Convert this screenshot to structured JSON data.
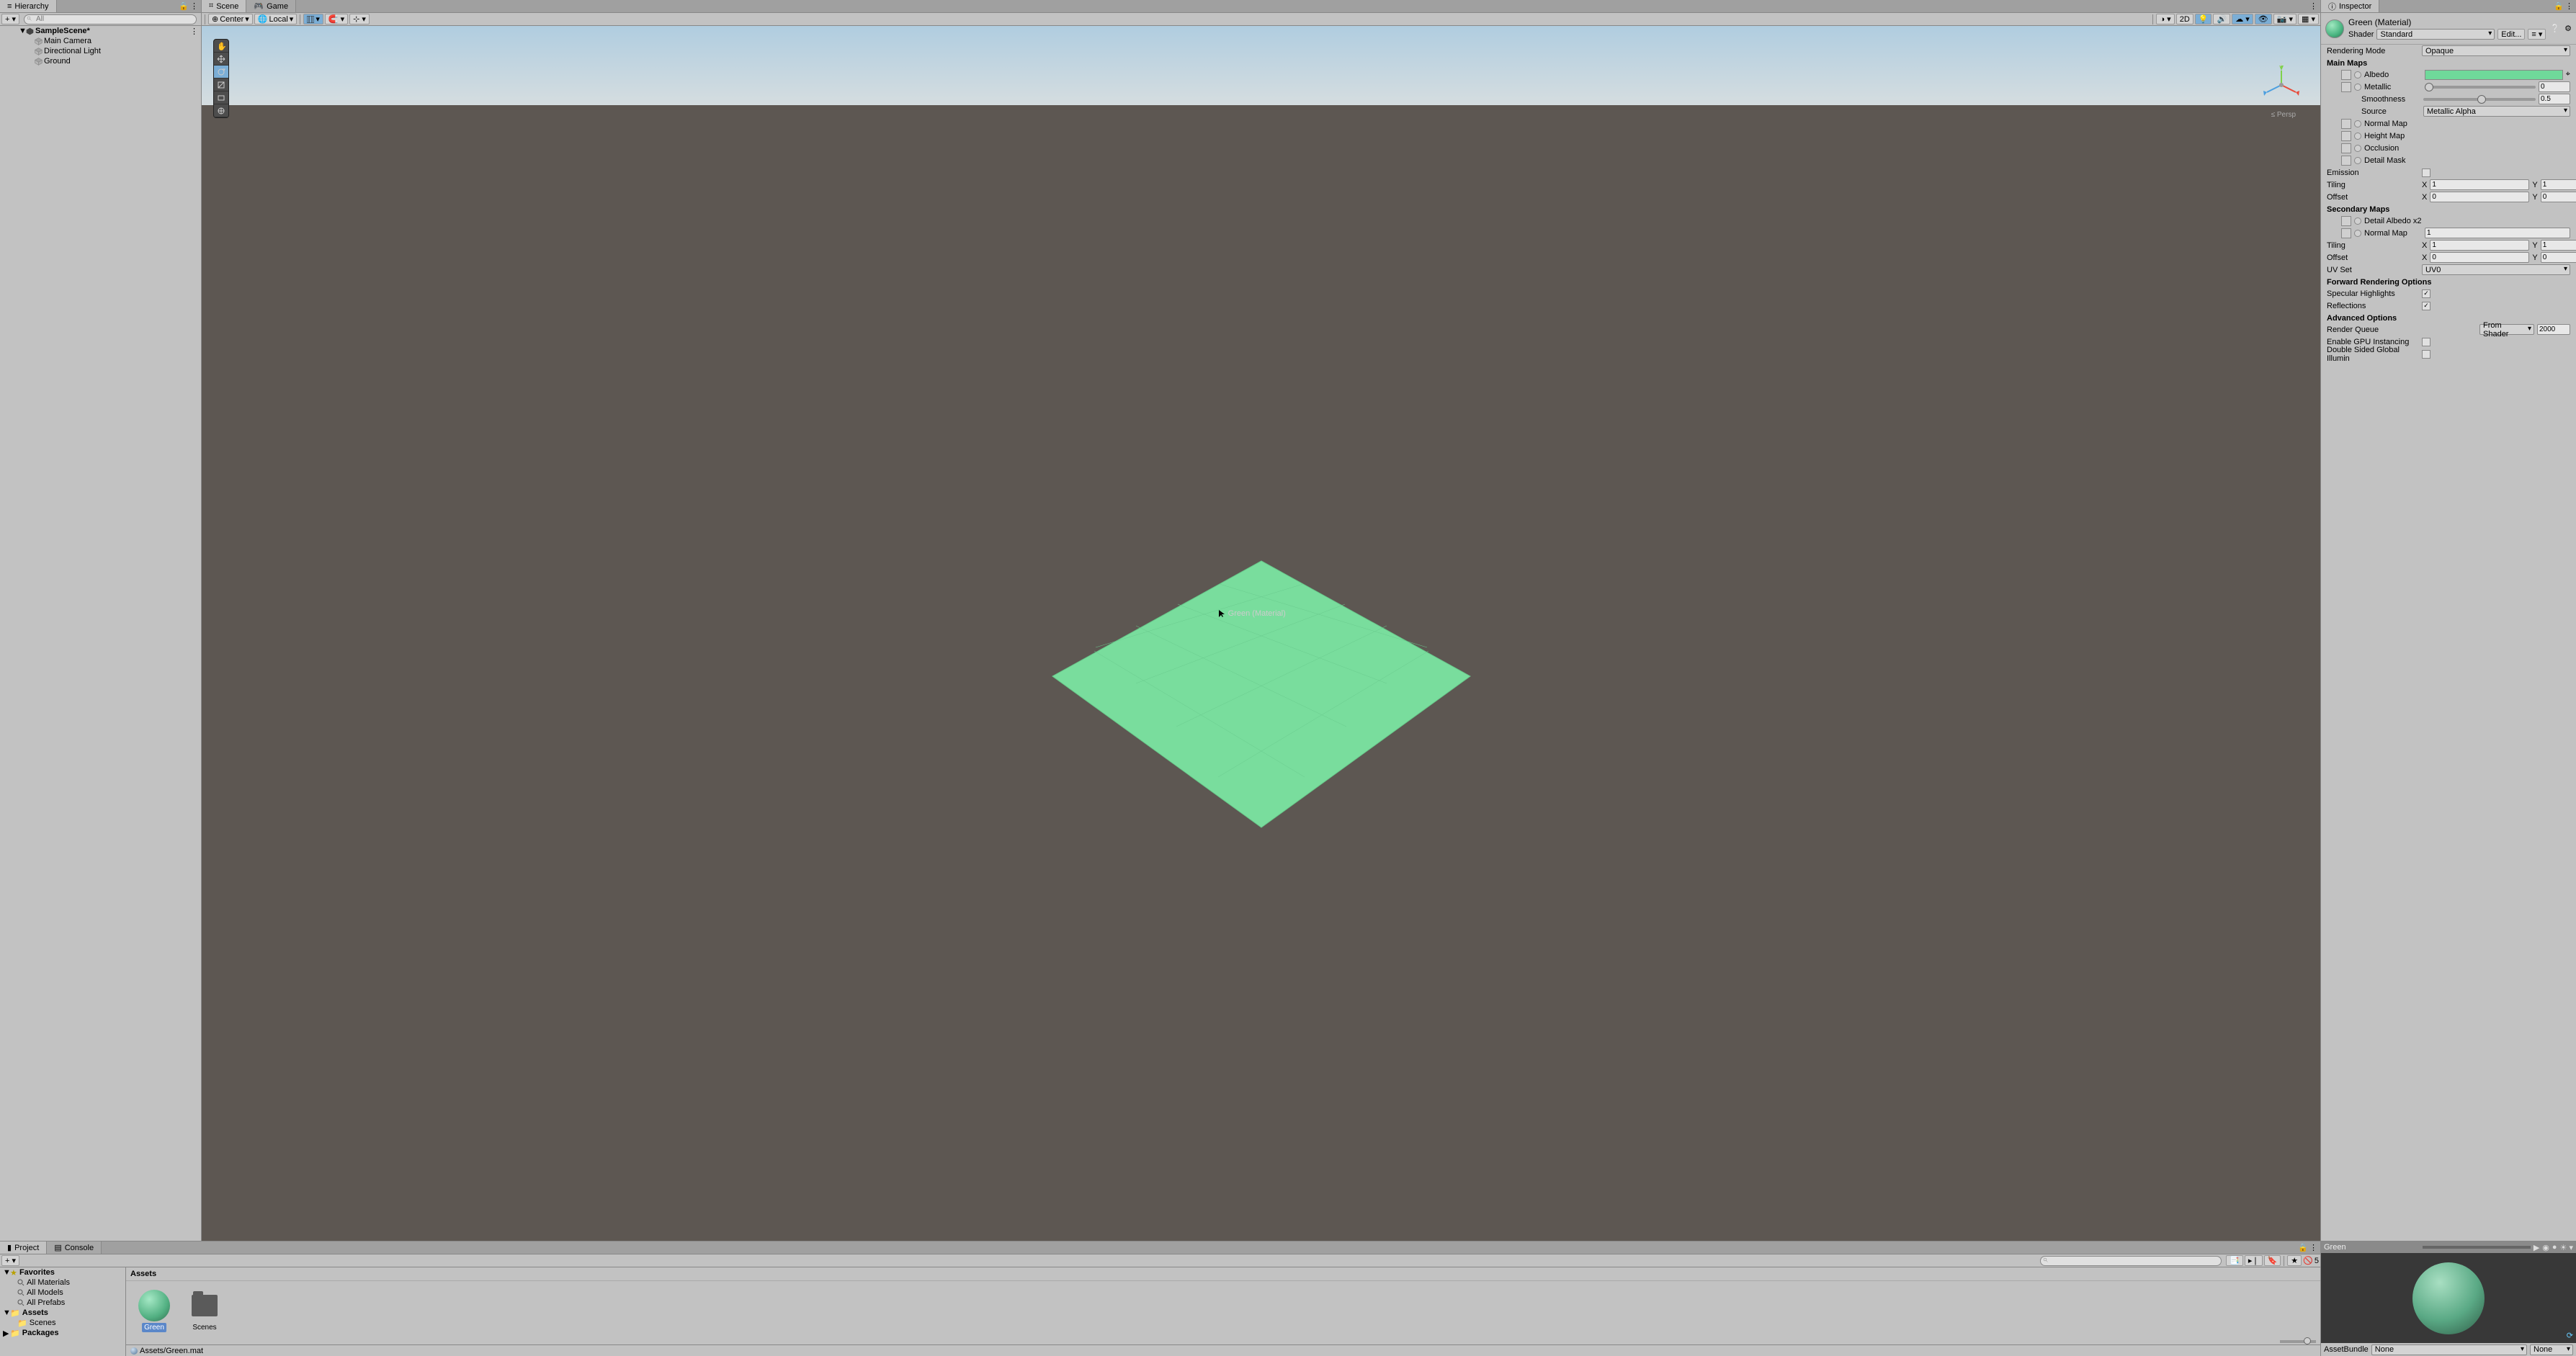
{
  "hierarchy": {
    "tab": "Hierarchy",
    "search_placeholder": "All",
    "scene_name": "SampleScene*",
    "items": [
      "Main Camera",
      "Directional Light",
      "Ground"
    ]
  },
  "scene": {
    "tab_scene": "Scene",
    "tab_game": "Game",
    "pivot_btn": "Center",
    "space_btn": "Local",
    "dim2d_btn": "2D",
    "persp_label": "≤ Persp",
    "drag_label": "Green (Material)",
    "axis_y": "y"
  },
  "inspector": {
    "tab": "Inspector",
    "material_name": "Green (Material)",
    "shader_label": "Shader",
    "shader_value": "Standard",
    "edit_btn": "Edit...",
    "rendering_mode_label": "Rendering Mode",
    "rendering_mode_value": "Opaque",
    "main_maps": "Main Maps",
    "albedo": "Albedo",
    "metallic_label": "Metallic",
    "metallic_value": "0",
    "smoothness_label": "Smoothness",
    "smoothness_value": "0.5",
    "source_label": "Source",
    "source_value": "Metallic Alpha",
    "normal_map": "Normal Map",
    "height_map": "Height Map",
    "occlusion": "Occlusion",
    "detail_mask": "Detail Mask",
    "emission": "Emission",
    "tiling": "Tiling",
    "tiling_x": "1",
    "tiling_y": "1",
    "offset": "Offset",
    "offset_x": "0",
    "offset_y": "0",
    "secondary_maps": "Secondary Maps",
    "detail_albedo": "Detail Albedo x2",
    "normal_map2": "Normal Map",
    "normal_map2_val": "1",
    "tiling2_x": "1",
    "tiling2_y": "1",
    "offset2_x": "0",
    "offset2_y": "0",
    "uv_set_label": "UV Set",
    "uv_set_value": "UV0",
    "forward_opts": "Forward Rendering Options",
    "specular_label": "Specular Highlights",
    "reflections_label": "Reflections",
    "advanced_opts": "Advanced Options",
    "render_queue_label": "Render Queue",
    "render_queue_mode": "From Shader",
    "render_queue_value": "2000",
    "gpu_inst_label": "Enable GPU Instancing",
    "double_sided_label": "Double Sided Global Illumin",
    "x": "X",
    "y": "Y"
  },
  "project": {
    "tab_project": "Project",
    "tab_console": "Console",
    "vis_count": "5",
    "favorites": "Favorites",
    "fav_items": [
      "All Materials",
      "All Models",
      "All Prefabs"
    ],
    "assets": "Assets",
    "assets_children": [
      "Scenes"
    ],
    "packages": "Packages",
    "breadcrumb": "Assets",
    "grid_items": [
      {
        "name": "Green",
        "type": "material",
        "selected": true
      },
      {
        "name": "Scenes",
        "type": "folder",
        "selected": false
      }
    ],
    "status_path": "Assets/Green.mat",
    "search_placeholder": ""
  },
  "preview": {
    "title": "Green",
    "assetbundle_label": "AssetBundle",
    "bundle_value": "None",
    "variant_value": "None"
  }
}
